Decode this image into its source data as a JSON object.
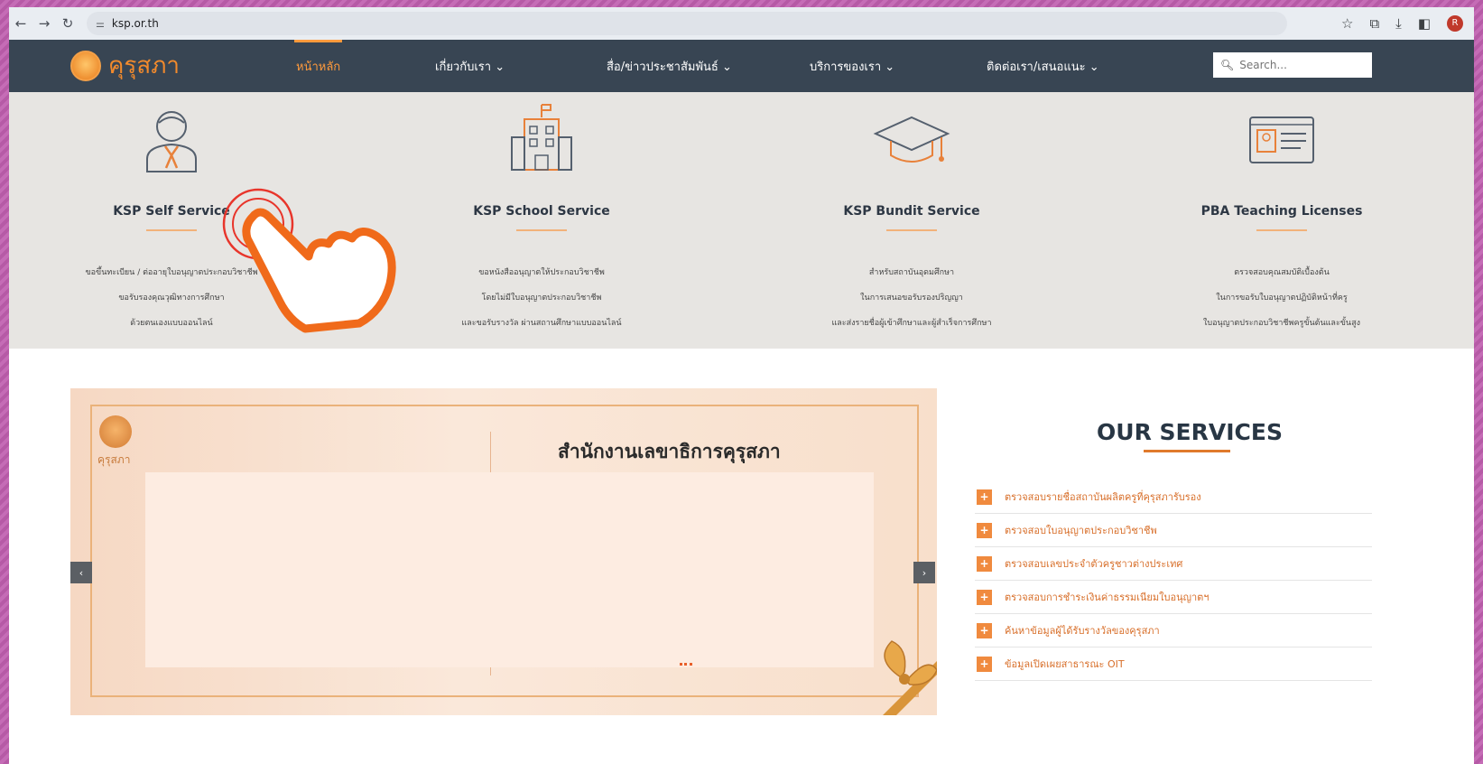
{
  "browser": {
    "url": "ksp.or.th"
  },
  "header": {
    "logo_text": "คุรุสภา",
    "nav": [
      "หน้าหลัก",
      "เกี่ยวกับเรา ⌄",
      "สื่อ/ข่าวประชาสัมพันธ์ ⌄",
      "บริการของเรา ⌄",
      "ติดต่อเรา/เสนอแนะ ⌄"
    ],
    "search_placeholder": "Search..."
  },
  "services": [
    {
      "title": "KSP Self Service",
      "icon": "person-icon",
      "lines": [
        "ขอขึ้นทะเบียน / ต่ออายุใบอนุญาตประกอบวิชาชีพ",
        "ขอรับรองคุณวุฒิทางการศึกษา",
        "ด้วยตนเองแบบออนไลน์"
      ]
    },
    {
      "title": "KSP School Service",
      "icon": "school-icon",
      "lines": [
        "ขอหนังสืออนุญาตให้ประกอบวิชาชีพ",
        "โดยไม่มีใบอนุญาตประกอบวิชาชีพ",
        "และขอรับรางวัล ผ่านสถานศึกษาแบบออนไลน์"
      ]
    },
    {
      "title": "KSP Bundit Service",
      "icon": "graduation-cap-icon",
      "lines": [
        "สำหรับสถาบันอุดมศึกษา",
        "ในการเสนอขอรับรองปริญญา",
        "และส่งรายชื่อผู้เข้าศึกษาและผู้สำเร็จการศึกษา"
      ]
    },
    {
      "title": "PBA Teaching Licenses",
      "icon": "license-card-icon",
      "lines": [
        "ตรวจสอบคุณสมบัติเบื้องต้น",
        "ในการขอรับใบอนุญาตปฏิบัติหน้าที่ครู",
        "ใบอนุญาตประกอบวิชาชีพครูขั้นต้นและขั้นสูง"
      ]
    }
  ],
  "banner": {
    "logo_text": "คุรุสภา",
    "title": "สำนักงานเลขาธิการคุรุสภา",
    "prev": "‹",
    "next": "›"
  },
  "our_services": {
    "title": "OUR SERVICES",
    "items": [
      "ตรวจสอบรายชื่อสถาบันผลิตครูที่คุรุสภารับรอง",
      "ตรวจสอบใบอนุญาตประกอบวิชาชีพ",
      "ตรวจสอบเลขประจำตัวครูชาวต่างประเทศ",
      "ตรวจสอบการชำระเงินค่าธรรมเนียมใบอนุญาตฯ",
      "ค้นหาข้อมูลผู้ได้รับรางวัลของคุรุสภา",
      "ข้อมูลเปิดเผยสาธารณะ OIT"
    ]
  },
  "colors": {
    "header_bg": "#384553",
    "accent": "#f08a3e",
    "band_bg": "#e7e5e2"
  }
}
